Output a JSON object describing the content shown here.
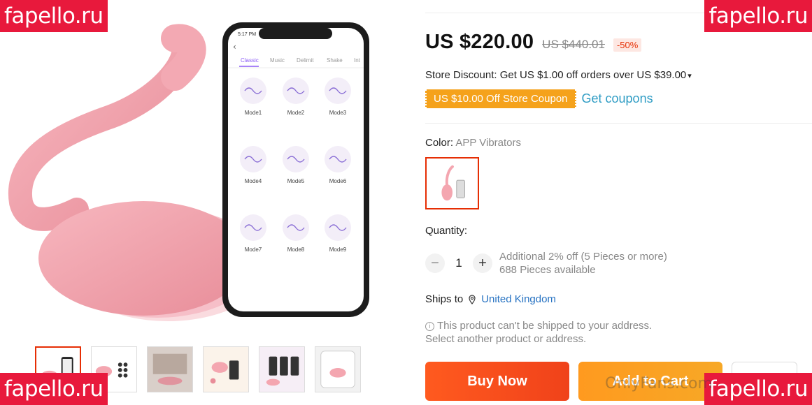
{
  "watermarks": {
    "top_left": "fapello.ru",
    "top_right": "fapello.ru",
    "bottom_left": "fapello.ru",
    "bottom_right": "fapello.ru",
    "overlay": "OnlyFans.com"
  },
  "phone": {
    "time": "5:17 PM",
    "tabs": [
      "Classic",
      "Music",
      "Delimit",
      "Shake",
      "Int"
    ],
    "modes": [
      "Mode1",
      "Mode2",
      "Mode3",
      "Mode4",
      "Mode5",
      "Mode6",
      "Mode7",
      "Mode8",
      "Mode9"
    ]
  },
  "product": {
    "price": "US $220.00",
    "original_price": "US $440.01",
    "discount": "-50%",
    "store_discount": "Store Discount: Get US $1.00 off orders over US $39.00",
    "coupon": "US $10.00 Off Store Coupon",
    "get_coupons": "Get coupons",
    "color_label": "Color:",
    "color_value": "APP Vibrators",
    "quantity_label": "Quantity:",
    "quantity": "1",
    "additional_discount": "Additional 2% off (5 Pieces or more)",
    "available": "688 Pieces available",
    "ships_to_label": "Ships to",
    "ships_to_country": "United Kingdom",
    "notice_line1": "This product can't be shipped to your address.",
    "notice_line2": "Select another product or address.",
    "buy_now": "Buy Now",
    "add_to_cart": "Add to Cart"
  },
  "colors": {
    "accent": "#e62e04",
    "coupon": "#f5a21b",
    "link": "#2672c2",
    "product_pink": "#f4a6b0"
  }
}
